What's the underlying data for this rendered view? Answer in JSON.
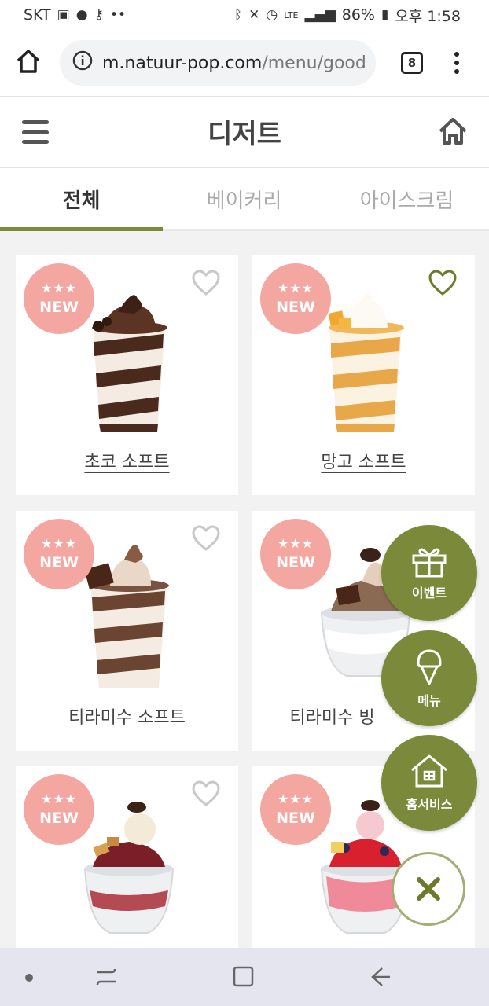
{
  "status_bar": {
    "carrier": "SKT",
    "app_icons": [
      "image-icon",
      "kakaotalk-icon",
      "vpn-key-icon",
      "more-dots-icon"
    ],
    "system_icons": [
      "bluetooth-icon",
      "mute-icon",
      "alarm-icon",
      "lte-icon",
      "signal-icon"
    ],
    "battery": "86%",
    "time": "오후 1:58"
  },
  "browser": {
    "url_host": "m.natuur-pop.com",
    "url_path": "/menu/good",
    "tab_count": "8"
  },
  "header": {
    "title": "디저트"
  },
  "tabs": [
    {
      "label": "전체",
      "active": true
    },
    {
      "label": "베이커리",
      "active": false
    },
    {
      "label": "아이스크림",
      "active": false
    }
  ],
  "products": [
    {
      "name": "초코 소프트",
      "badge": "NEW",
      "favorited": false
    },
    {
      "name": "망고 소프트",
      "badge": "NEW",
      "favorited": true
    },
    {
      "name": "티라미수 소프트",
      "badge": "NEW",
      "favorited": false
    },
    {
      "name": "티라미수 빙",
      "badge": "NEW",
      "favorited": false
    },
    {
      "name": "",
      "badge": "NEW",
      "favorited": false
    },
    {
      "name": "",
      "badge": "NEW",
      "favorited": false
    }
  ],
  "floating_menu": {
    "event_label": "이벤트",
    "menu_label": "메뉴",
    "home_service_label": "홈서비스"
  },
  "colors": {
    "accent": "#7a8a3a",
    "badge": "#f4a7a0"
  }
}
